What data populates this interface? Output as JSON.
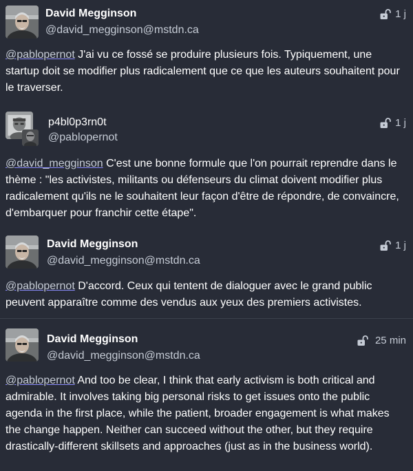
{
  "posts": [
    {
      "author_name": "David Megginson",
      "author_handle": "@david_megginson@mstdn.ca",
      "visibility_icon": "unlock-icon",
      "time": "1 j",
      "mention": "@pablopernot",
      "text": " J'ai vu ce fossé se produire plusieurs fois. Typiquement, une startup doit se modifier plus radicalement que ce que les auteurs souhaitent pour le traverser."
    },
    {
      "author_name": "p4bl0p3rn0t",
      "author_handle": "@pablopernot",
      "visibility_icon": "unlock-icon",
      "time": "1 j",
      "mention": "@david_megginson",
      "text": " C'est une bonne formule que l'on pourrait reprendre dans le thème : \"les activistes, militants ou défenseurs du climat doivent modifier plus radicalement qu'ils ne le souhaitent leur façon d'être de répondre, de convaincre, d'embarquer pour franchir cette étape\"."
    },
    {
      "author_name": "David Megginson",
      "author_handle": "@david_megginson@mstdn.ca",
      "visibility_icon": "unlock-icon",
      "time": "1 j",
      "mention": "@pablopernot",
      "text": " D'accord. Ceux qui tentent de dialoguer avec le grand public peuvent apparaître comme des vendus aux yeux des premiers activistes."
    },
    {
      "author_name": "David Megginson",
      "author_handle": "@david_megginson@mstdn.ca",
      "visibility_icon": "unlock-icon",
      "time": "25 min",
      "mention": "@pablopernot",
      "text": " And too be clear, I think that early activism is both critical and admirable. It involves taking big personal risks to get issues onto the public agenda in the first place, while the patient, broader engagement is what makes the change happen. Neither can succeed without the other, but they require drastically-different skillsets and approaches (just as in the business world)."
    }
  ]
}
